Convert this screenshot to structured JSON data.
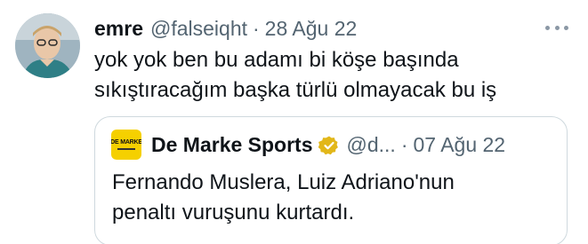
{
  "tweet": {
    "display_name": "emre",
    "handle": "@falseiqht",
    "separator": "·",
    "date": "28 Ağu 22",
    "text_lines": [
      "yok yok ben bu adamı bi köşe başında",
      "sıkıştıracağım başka türlü olmayacak bu iş"
    ],
    "avatar_icon": "profile-photo",
    "more_icon": "more-horizontal-icon"
  },
  "quote": {
    "display_name": "De Marke Sports",
    "handle": "@d...",
    "separator": "·",
    "date": "07 Ağu 22",
    "logo_text": "DE MARKE",
    "verified_icon": "verified-gold-badge-icon",
    "text_lines": [
      "Fernando Muslera, Luiz Adriano'nun",
      "penaltı vuruşunu kurtardı."
    ]
  },
  "colors": {
    "text_primary": "#0f1419",
    "text_secondary": "#536471",
    "border": "#cfd9de",
    "verified_gold": "#e2b719",
    "logo_yellow": "#f5d000"
  }
}
